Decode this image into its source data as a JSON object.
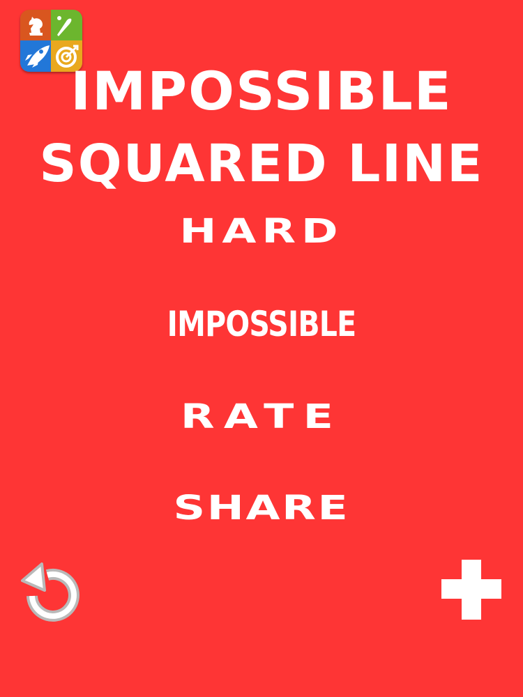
{
  "app_icon": {
    "icons": [
      "knight-icon",
      "bat-icon",
      "rocket-icon",
      "target-icon"
    ],
    "colors": [
      "#d9561f",
      "#6cb62e",
      "#2277d8",
      "#e9a81e"
    ]
  },
  "title": {
    "line1": "IMPOSSIBLE",
    "line2": "SQUARED LINE"
  },
  "menu": {
    "hard": "HARD",
    "impossible": "IMPOSSIBLE",
    "rate": "RATE",
    "share": "SHARE"
  },
  "controls": {
    "left_icon": "replay-icon",
    "right_icon": "plus-icon"
  },
  "colors": {
    "background": "#fe3535",
    "text": "#ffffff"
  }
}
